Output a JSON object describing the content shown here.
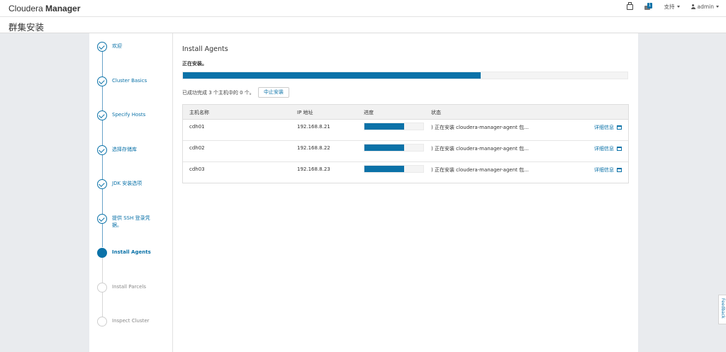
{
  "header": {
    "brand_light": "Cloudera ",
    "brand_bold": "Manager",
    "notification_count": "1",
    "support_label": "支持",
    "user_label": "admin"
  },
  "page": {
    "title": "群集安装"
  },
  "steps": [
    {
      "label": "欢迎",
      "state": "done"
    },
    {
      "label": "Cluster Basics",
      "state": "done"
    },
    {
      "label": "Specify Hosts",
      "state": "done"
    },
    {
      "label": "选择存储库",
      "state": "done"
    },
    {
      "label": "JDK 安装选项",
      "state": "done"
    },
    {
      "label": "提供 SSH 登录凭据。",
      "state": "done"
    },
    {
      "label": "Install Agents",
      "state": "active"
    },
    {
      "label": "Install Parcels",
      "state": "todo"
    },
    {
      "label": "Inspect Cluster",
      "state": "todo"
    }
  ],
  "main": {
    "title": "Install Agents",
    "status": "正在安装。",
    "overall_progress": 0.67,
    "summary": "已成功完成 3 个主机中的 0 个。",
    "abort_label": "中止安装"
  },
  "table": {
    "headers": {
      "host": "主机名称",
      "ip": "IP 地址",
      "progress": "进度",
      "status": "状态"
    },
    "rows": [
      {
        "host": "cdh01",
        "ip": "192.168.8.21",
        "progress": 0.67,
        "status": ") 正在安装 cloudera-manager-agent 包...",
        "details": "详细信息"
      },
      {
        "host": "cdh02",
        "ip": "192.168.8.22",
        "progress": 0.67,
        "status": ") 正在安装 cloudera-manager-agent 包...",
        "details": "详细信息"
      },
      {
        "host": "cdh03",
        "ip": "192.168.8.23",
        "progress": 0.67,
        "status": ") 正在安装 cloudera-manager-agent 包...",
        "details": "详细信息"
      }
    ]
  },
  "feedback_label": "Feedback",
  "colors": {
    "accent": "#0b72a8"
  }
}
